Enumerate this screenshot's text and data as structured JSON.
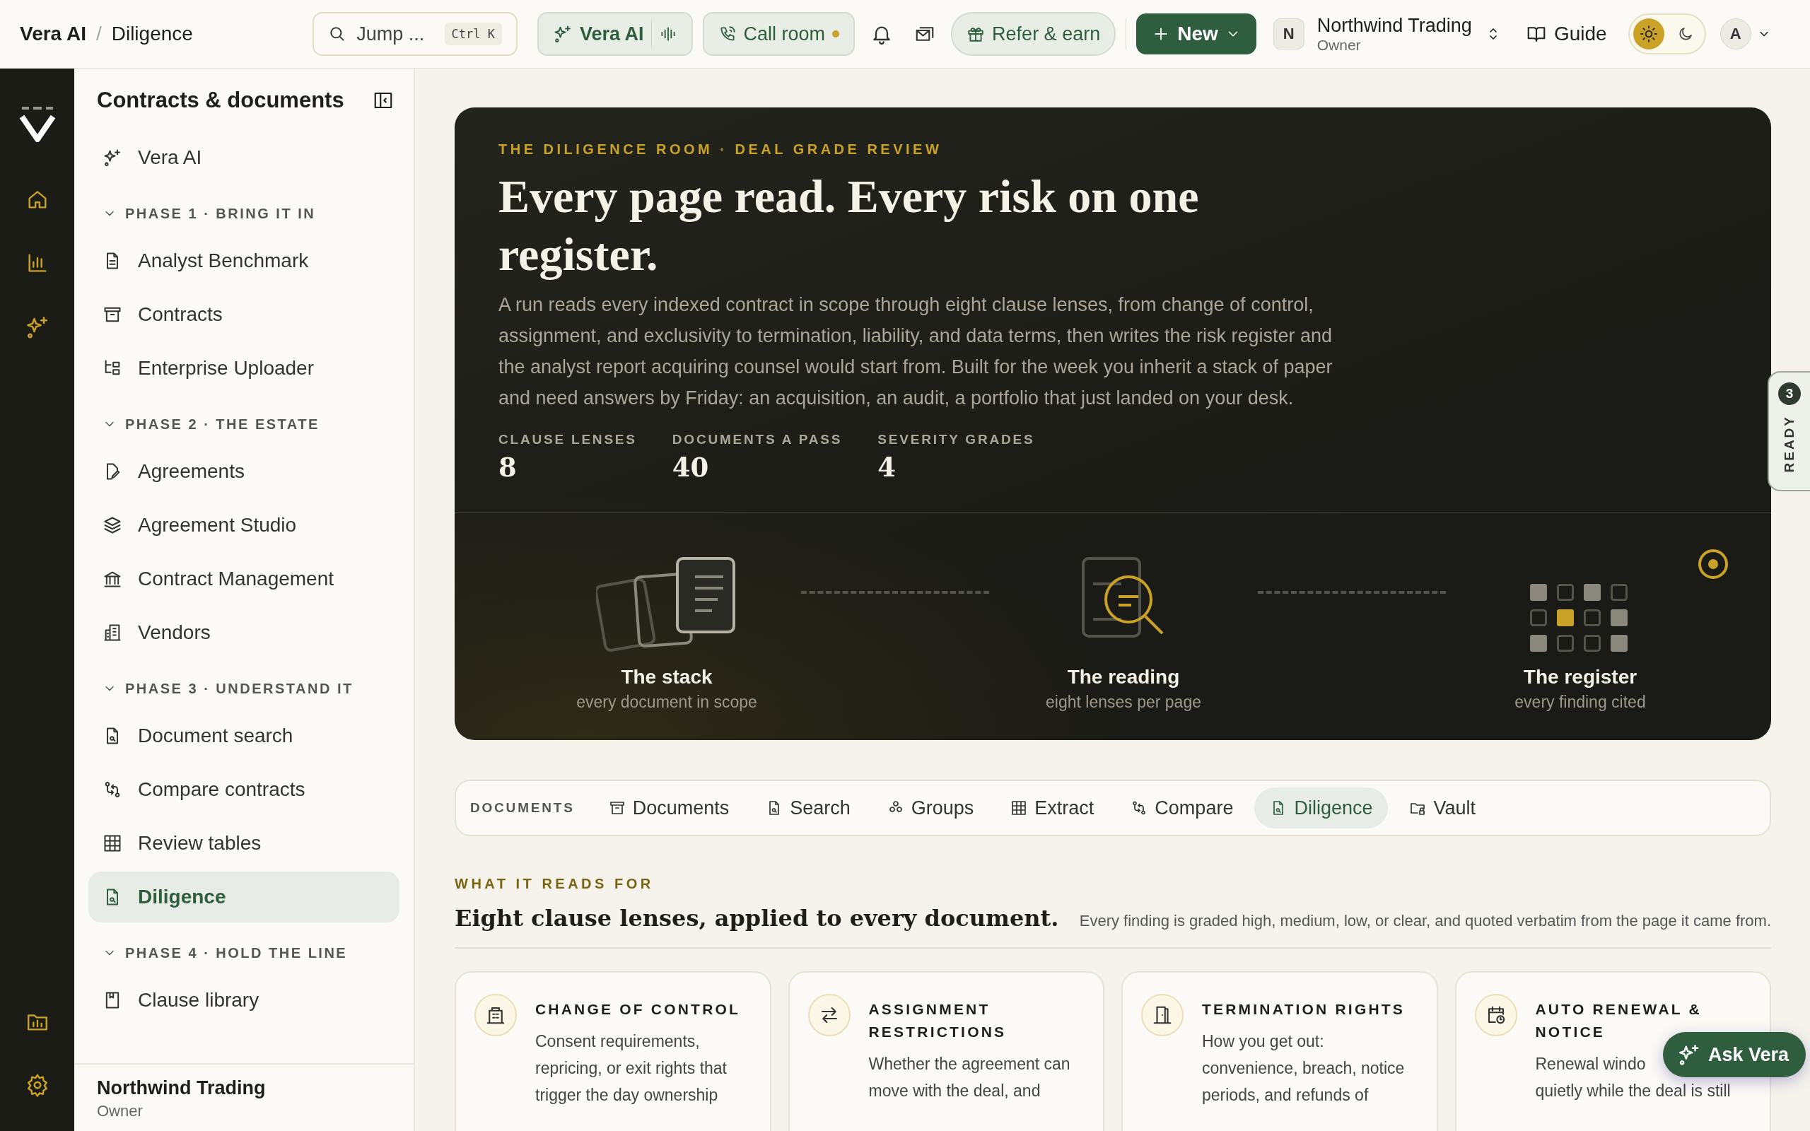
{
  "topbar": {
    "breadcrumb": [
      "Vera AI",
      "Diligence"
    ],
    "breadcrumb_separator": "/",
    "search": {
      "placeholder": "Jump ...",
      "shortcut": "Ctrl K"
    },
    "vera_button": "Vera AI",
    "call_room": {
      "label": "Call room",
      "live": true
    },
    "refer": "Refer & earn",
    "new_button": "New",
    "org": {
      "avatar": "N",
      "name": "Northwind Trading",
      "role": "Owner"
    },
    "guide": "Guide",
    "theme_options": [
      {
        "selected": true
      },
      {
        "selected": false
      }
    ],
    "account": {
      "avatar": "A"
    }
  },
  "sidebar": {
    "title": "Contracts & documents",
    "items": [
      {
        "kind": "link",
        "label": "Vera AI",
        "selected": false
      },
      {
        "kind": "section",
        "label": "PHASE 1 · BRING IT IN",
        "expanded": true,
        "children": [
          {
            "label": "Analyst Benchmark",
            "selected": false
          },
          {
            "label": "Contracts",
            "selected": false
          },
          {
            "label": "Enterprise Uploader",
            "selected": false
          }
        ]
      },
      {
        "kind": "section",
        "label": "PHASE 2 · THE ESTATE",
        "expanded": true,
        "children": [
          {
            "label": "Agreements",
            "selected": false
          },
          {
            "label": "Agreement Studio",
            "selected": false
          },
          {
            "label": "Contract Management",
            "selected": false
          },
          {
            "label": "Vendors",
            "selected": false
          }
        ]
      },
      {
        "kind": "section",
        "label": "PHASE 3 · UNDERSTAND IT",
        "expanded": true,
        "children": [
          {
            "label": "Document search",
            "selected": false
          },
          {
            "label": "Compare contracts",
            "selected": false
          },
          {
            "label": "Review tables",
            "selected": false
          },
          {
            "label": "Diligence",
            "selected": true
          }
        ]
      },
      {
        "kind": "section",
        "label": "PHASE 4 · HOLD THE LINE",
        "expanded": true,
        "children": [
          {
            "label": "Clause library",
            "selected": false
          }
        ]
      }
    ],
    "footer": {
      "name": "Northwind Trading",
      "role": "Owner"
    }
  },
  "hero": {
    "eyebrow": "THE DILIGENCE ROOM · DEAL GRADE REVIEW",
    "title": "Every page read. Every risk on one register.",
    "body": "A run reads every indexed contract in scope through eight clause lenses, from change of control, assignment, and exclusivity to termination, liability, and data terms, then writes the risk register and the analyst report acquiring counsel would start from. Built for the week you inherit a stack of paper and need answers by Friday: an acquisition, an audit, a portfolio that just landed on your desk.",
    "stats": [
      {
        "label": "CLAUSE LENSES",
        "value": "8"
      },
      {
        "label": "DOCUMENTS A PASS",
        "value": "40"
      },
      {
        "label": "SEVERITY GRADES",
        "value": "4"
      }
    ],
    "steps": [
      {
        "title": "The stack",
        "subtitle": "every document in scope"
      },
      {
        "title": "The reading",
        "subtitle": "eight lenses per page"
      },
      {
        "title": "The register",
        "subtitle": "every finding cited"
      }
    ]
  },
  "ready_tab": {
    "count": "3",
    "label": "READY"
  },
  "doc_tabs": {
    "label": "DOCUMENTS",
    "tabs": [
      {
        "label": "Documents",
        "selected": false
      },
      {
        "label": "Search",
        "selected": false
      },
      {
        "label": "Groups",
        "selected": false
      },
      {
        "label": "Extract",
        "selected": false
      },
      {
        "label": "Compare",
        "selected": false
      },
      {
        "label": "Diligence",
        "selected": true
      },
      {
        "label": "Vault",
        "selected": false
      }
    ]
  },
  "section": {
    "eyebrow": "WHAT IT READS FOR",
    "title": "Eight clause lenses, applied to every document.",
    "note": "Every finding is graded high, medium, low, or clear, and quoted verbatim from the page it came from."
  },
  "cards": [
    {
      "title": "CHANGE OF CONTROL",
      "lines": [
        "Consent requirements,",
        "repricing, or exit rights that",
        "trigger the day ownership"
      ]
    },
    {
      "title": "ASSIGNMENT RESTRICTIONS",
      "lines": [
        "Whether the agreement can",
        "move with the deal, and"
      ]
    },
    {
      "title": "TERMINATION RIGHTS",
      "lines": [
        "How you get out:",
        "convenience, breach, notice",
        "periods, and refunds of"
      ]
    },
    {
      "title": "AUTO RENEWAL & NOTICE",
      "lines": [
        "Renewal windo",
        "quietly while the deal is still"
      ]
    }
  ],
  "ask_vera": "Ask Vera"
}
